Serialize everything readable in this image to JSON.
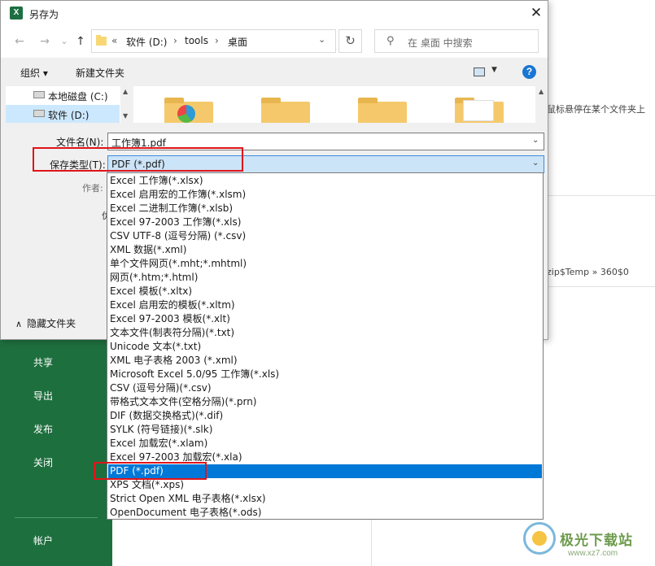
{
  "dialog": {
    "title": "另存为",
    "title_icon": "X",
    "close": "✕"
  },
  "nav": {
    "back": "←",
    "forward": "→",
    "recent": "⌄",
    "up": "↑",
    "address": {
      "prefix": "«",
      "crumbs": [
        "软件 (D:)",
        "tools",
        "桌面"
      ],
      "separator": "›"
    },
    "refresh": "↻",
    "search_placeholder": "在 桌面 中搜索"
  },
  "toolbar": {
    "organize": "组织 ▾",
    "new_folder": "新建文件夹",
    "help": "?"
  },
  "tree": {
    "items": [
      {
        "label": "本地磁盘 (C:)",
        "icon": "drive-icon"
      },
      {
        "label": "软件 (D:)",
        "icon": "drive-icon",
        "selected": true
      }
    ]
  },
  "form": {
    "filename_label": "文件名(N):",
    "filename_value": "工作簿1.pdf",
    "type_label": "保存类型(T):",
    "type_value": "PDF (*.pdf)",
    "author_label": "作者:",
    "hide_folders": "隐藏文件夹"
  },
  "type_options": [
    "Excel 工作簿(*.xlsx)",
    "Excel 启用宏的工作簿(*.xlsm)",
    "Excel 二进制工作簿(*.xlsb)",
    "Excel 97-2003 工作簿(*.xls)",
    "CSV UTF-8 (逗号分隔) (*.csv)",
    "XML 数据(*.xml)",
    "单个文件网页(*.mht;*.mhtml)",
    "网页(*.htm;*.html)",
    "Excel 模板(*.xltx)",
    "Excel 启用宏的模板(*.xltm)",
    "Excel 97-2003 模板(*.xlt)",
    "文本文件(制表符分隔)(*.txt)",
    "Unicode 文本(*.txt)",
    "XML 电子表格 2003 (*.xml)",
    "Microsoft Excel 5.0/95 工作簿(*.xls)",
    "CSV (逗号分隔)(*.csv)",
    "带格式文本文件(空格分隔)(*.prn)",
    "DIF (数据交换格式)(*.dif)",
    "SYLK (符号链接)(*.slk)",
    "Excel 加载宏(*.xlam)",
    "Excel 97-2003 加载宏(*.xla)",
    "PDF (*.pdf)",
    "XPS 文档(*.xps)",
    "Strict Open XML 电子表格(*.xlsx)",
    "OpenDocument 电子表格(*.ods)"
  ],
  "selected_option_index": 21,
  "background": {
    "nav": [
      "共享",
      "导出",
      "发布",
      "关闭",
      "帐户"
    ],
    "hint_text": "鼠标悬停在某个文件夹上",
    "path_text": "zip$Temp » 360$0"
  },
  "watermark": {
    "text": "极光下载站",
    "url": "www.xz7.com"
  },
  "colors": {
    "excel_green": "#1e6f3e",
    "highlight_blue": "#0078d7",
    "annotation_red": "#e0141a"
  }
}
